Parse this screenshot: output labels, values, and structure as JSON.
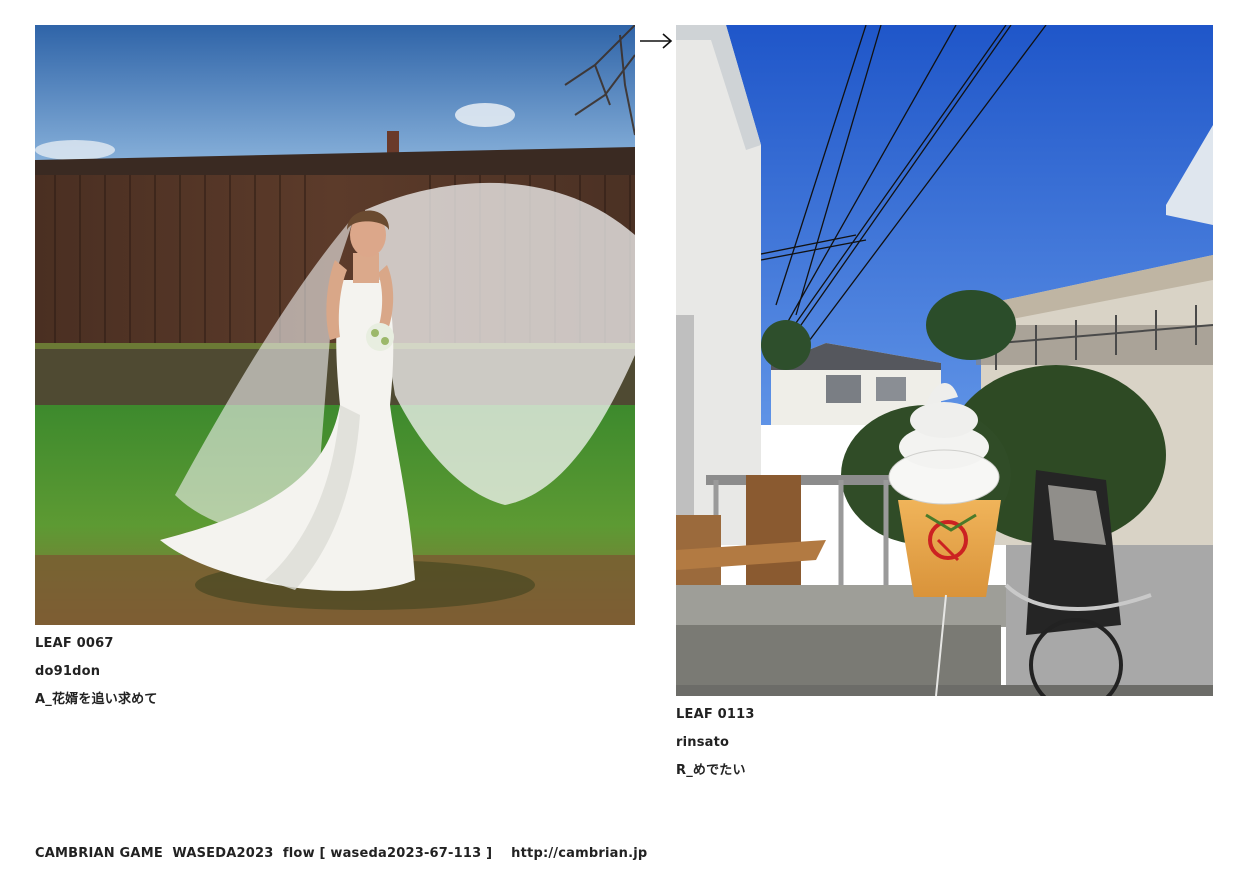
{
  "left_leaf": {
    "id_label": "LEAF 0067",
    "author": "do91don",
    "title": "A_花婿を追い求めて",
    "photo_icon": "bride-photo"
  },
  "right_leaf": {
    "id_label": "LEAF 0113",
    "author": "rinsato",
    "title": "R_めでたい",
    "photo_icon": "soft-serve-photo"
  },
  "navigation": {
    "arrow_glyph": "→",
    "arrow_icon": "right-arrow-icon"
  },
  "footer": {
    "brand": "CAMBRIAN GAME",
    "event": "WASEDA2023",
    "flow": "flow [ waseda2023-67-113 ]",
    "url": "http://cambrian.jp"
  }
}
